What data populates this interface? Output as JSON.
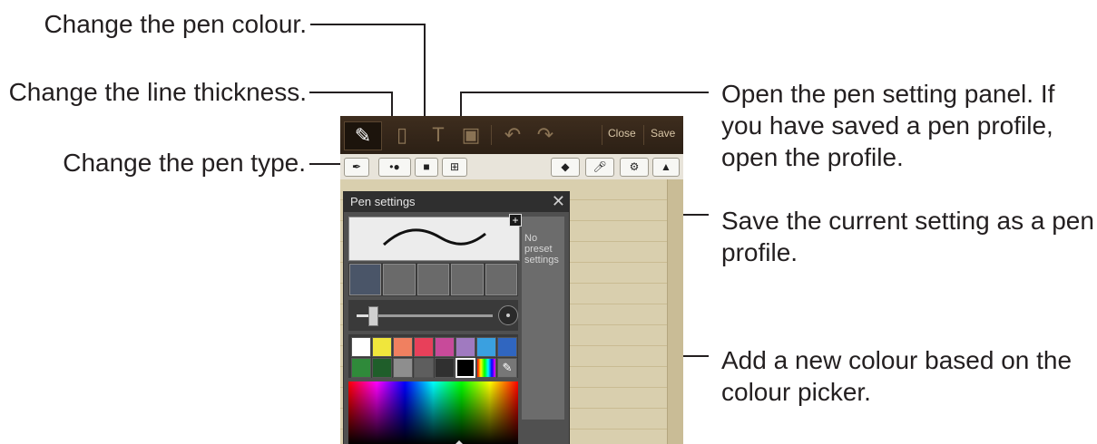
{
  "callouts": {
    "pen_colour": "Change the pen colour.",
    "line_thickness": "Change the line thickness.",
    "pen_type": "Change the pen type.",
    "setting_panel": "Open the pen setting panel. If\nyou have saved a pen profile,\nopen the profile.",
    "save_profile": "Save the current setting as a pen\nprofile.",
    "new_colour": "Add a new colour based on the\ncolour picker."
  },
  "app": {
    "topbar": {
      "close_label": "Close",
      "save_label": "Save"
    },
    "panel": {
      "title": "Pen settings",
      "close_glyph": "✕",
      "preset_text": "No\npreset\nsettings",
      "add_glyph": "+"
    },
    "palette": [
      "#ffffff",
      "#f0e63c",
      "#f08060",
      "#e8405a",
      "#c84a9a",
      "#a07ac0",
      "#3aa0e0",
      "#3066c0",
      "#2f8a3a",
      "#1f5e2a",
      "#8e8e8e",
      "#5e5e5e",
      "#303030",
      "#000000",
      "rainbow",
      "eyedropper"
    ]
  },
  "colors": {
    "brand_topbar": "#3e2d1e",
    "paper": "#d9cfae"
  }
}
